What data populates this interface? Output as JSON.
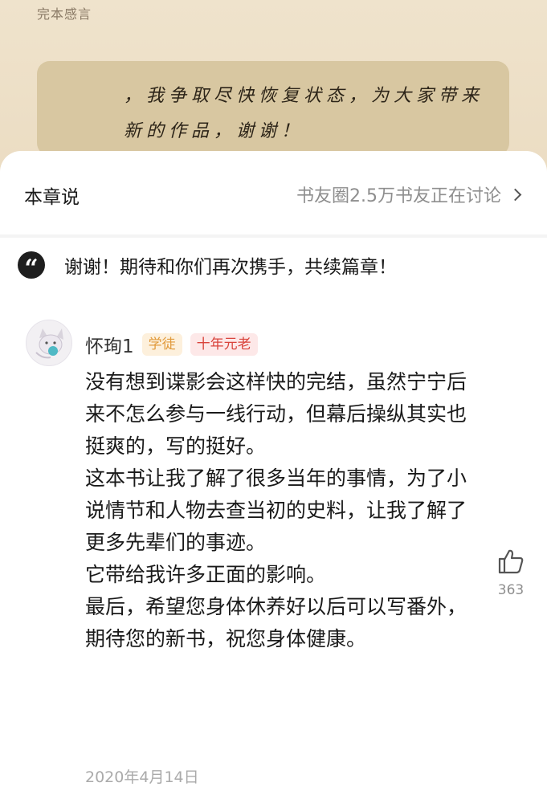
{
  "reader": {
    "header_text": "完本感言",
    "note_text": "，我争取尽快恢复状态，为大家带来新的作品，谢谢！"
  },
  "chapter_comments": {
    "title": "本章说",
    "link_label": "书友圈2.5万书友正在讨论"
  },
  "author_note": {
    "icon": "quote-icon",
    "text": "谢谢！期待和你们再次携手，共续篇章！"
  },
  "comment": {
    "username": "怀珣1",
    "badges": [
      "学徒",
      "十年元老"
    ],
    "paragraphs": [
      "没有想到谍影会这样快的完结，虽然宁宁后来不怎么参与一线行动，但幕后操纵其实也挺爽的，写的挺好。",
      "这本书让我了解了很多当年的事情，为了小说情节和人物去查当初的史料，让我了解了更多先辈们的事迹。",
      "它带给我许多正面的影响。",
      "最后，希望您身体休养好以后可以写番外，期待您的新书，祝您身体健康。"
    ],
    "date": "2020年4月14日",
    "likes": "363"
  },
  "colors": {
    "paper": "#efe3cc",
    "note_card": "#d8c7a1",
    "badge_apprentice": "#e19a3c",
    "badge_veteran": "#d9443c"
  }
}
